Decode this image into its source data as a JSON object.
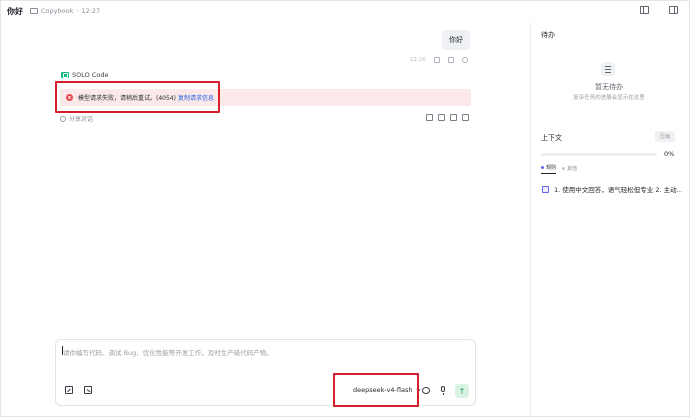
{
  "header": {
    "title": "你好",
    "workspace": "Copybook",
    "time": "12:27"
  },
  "chat": {
    "user_message": "你好",
    "user_message_time": "12:26",
    "agent_name": "SOLO Code",
    "error": {
      "icon": "x",
      "message": "模型请求失败，请稍后重试。(4054)",
      "link_label": "复制请求信息"
    },
    "share_label": "分享对话"
  },
  "input": {
    "placeholder": "请你编写代码、调试 Bug、优化性能等开发工作，及时生产级代码产物。",
    "model": "deepseek-v4-flash",
    "send_glyph": "↑"
  },
  "right_panel": {
    "todo_title": "待办",
    "todo_empty_title": "暂无待办",
    "todo_empty_subtitle": "复杂任务的进展会显示在这里",
    "context_title": "上下文",
    "context_button": "压缩",
    "context_percent": "0%",
    "context_fraction": 0.0,
    "tabs": [
      {
        "label": "规则"
      },
      {
        "label": "其他"
      }
    ],
    "rule_item": "1. 使用中文回答，语气轻松但专业 2. 主动…"
  },
  "colors": {
    "accent_green": "#22a560",
    "error_red": "#e5484d",
    "error_bg": "#fbe9e9",
    "annotation_red": "#d61f2c"
  }
}
